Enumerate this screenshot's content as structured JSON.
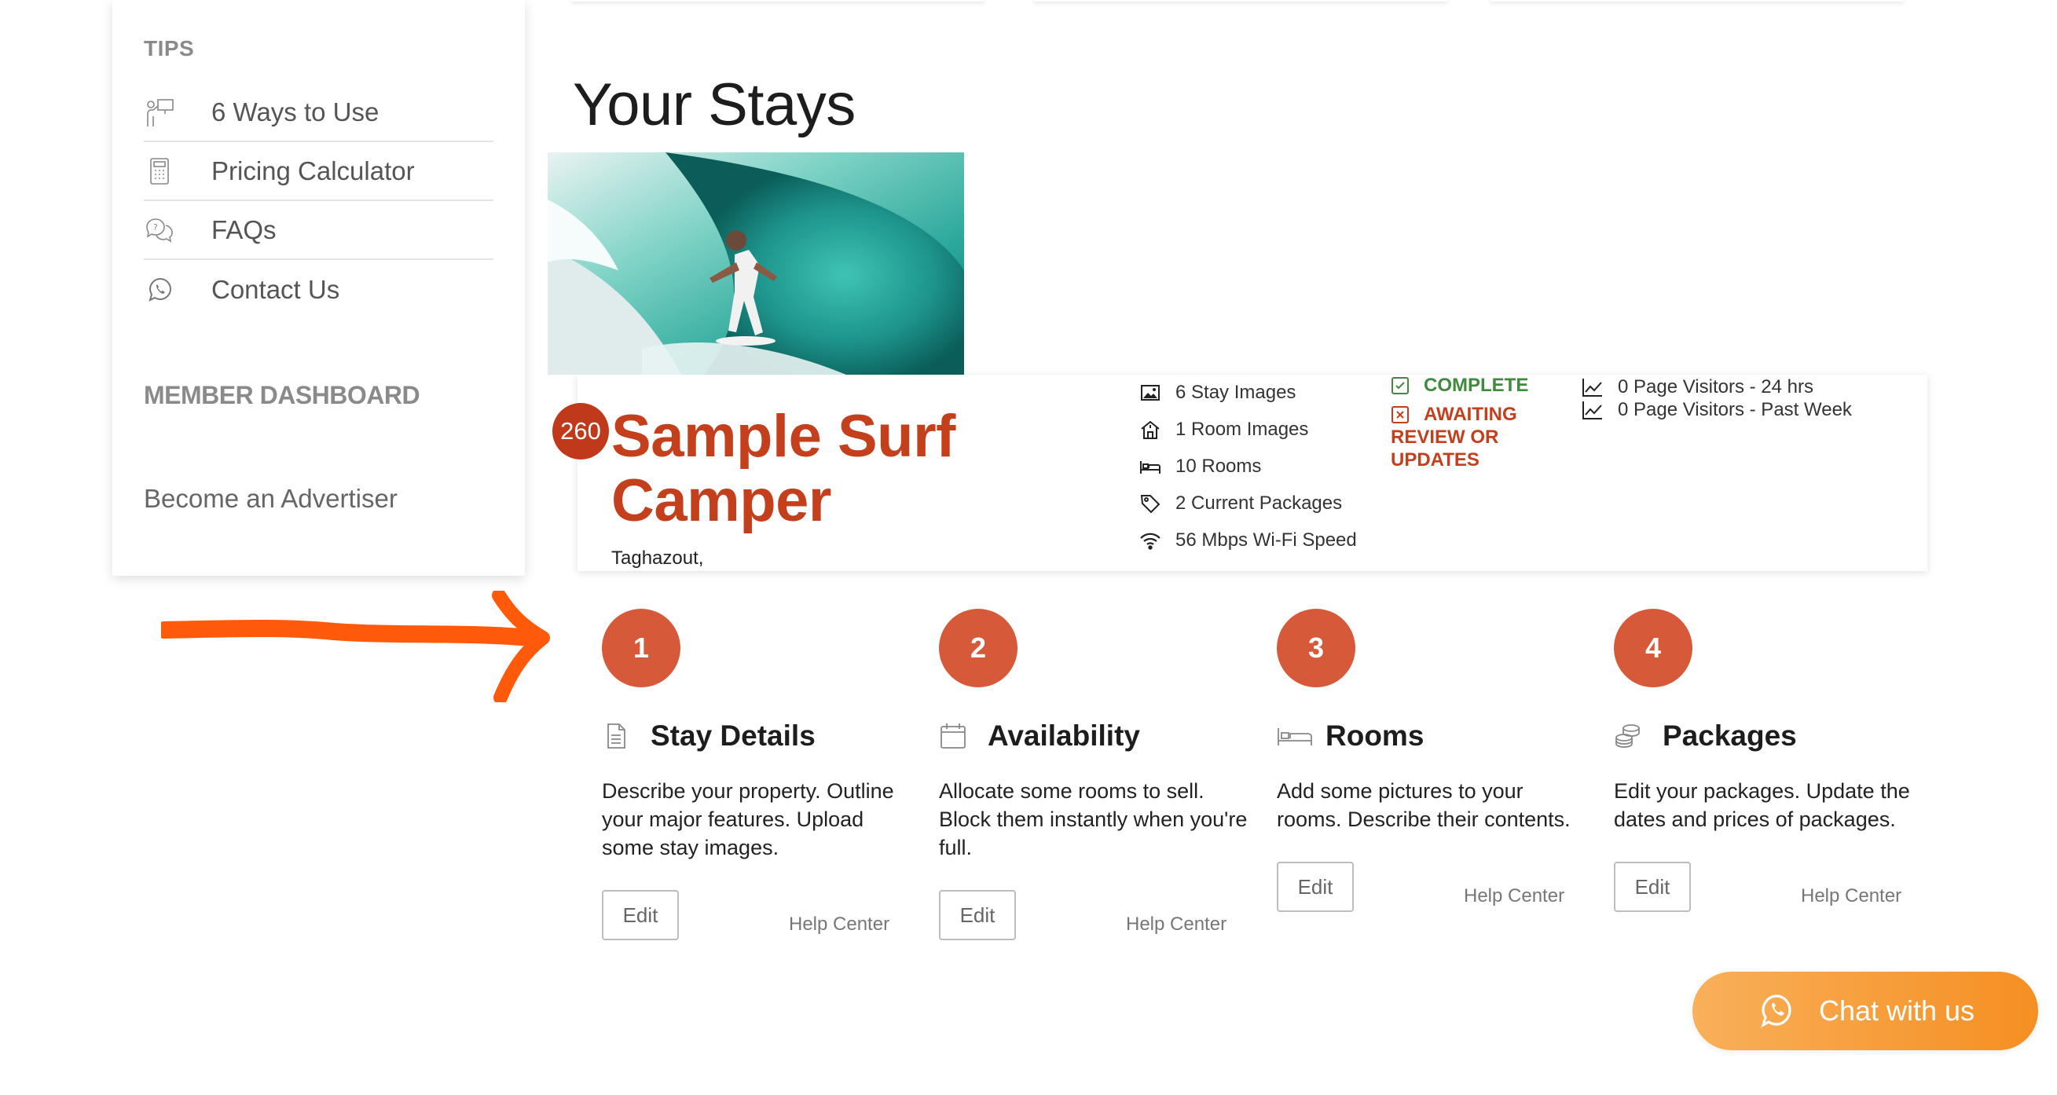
{
  "sidebar": {
    "tips_heading": "TIPS",
    "tips": [
      {
        "label": "6 Ways to Use",
        "icon": "presenter-icon"
      },
      {
        "label": "Pricing Calculator",
        "icon": "calculator-icon"
      },
      {
        "label": "FAQs",
        "icon": "chat-bubbles-icon"
      },
      {
        "label": "Contact Us",
        "icon": "whatsapp-icon"
      }
    ],
    "member_heading": "MEMBER DASHBOARD",
    "advertiser_link": "Become an Advertiser"
  },
  "page": {
    "title": "Your Stays"
  },
  "stay": {
    "badge": "260",
    "name": "Sample Surf Camper",
    "location": "Taghazout,",
    "image": "surfer-in-wave-photo",
    "stats": [
      {
        "label": "6 Stay Images",
        "icon": "image-icon"
      },
      {
        "label": "1 Room Images",
        "icon": "house-icon"
      },
      {
        "label": "10 Rooms",
        "icon": "bed-icon"
      },
      {
        "label": "2 Current Packages",
        "icon": "tag-icon"
      },
      {
        "label": "56 Mbps Wi-Fi Speed",
        "icon": "wifi-icon"
      }
    ],
    "status_complete": "COMPLETE",
    "status_awaiting": "AWAITING REVIEW OR UPDATES",
    "visitors": [
      {
        "label": "0 Page Visitors - 24 hrs",
        "icon": "chart-line-icon"
      },
      {
        "label": "0 Page Visitors - Past Week",
        "icon": "chart-line-icon"
      }
    ]
  },
  "steps": [
    {
      "number": "1",
      "title": "Stay Details",
      "icon": "document-icon",
      "description": "Describe your property. Outline your major features. Upload some stay images.",
      "edit_label": "Edit",
      "help_label": "Help Center"
    },
    {
      "number": "2",
      "title": "Availability",
      "icon": "calendar-icon",
      "description": "Allocate some rooms to sell. Block them instantly when you're full.",
      "edit_label": "Edit",
      "help_label": "Help Center"
    },
    {
      "number": "3",
      "title": "Rooms",
      "icon": "bed-icon",
      "description": "Add some pictures to your rooms. Describe their contents.",
      "edit_label": "Edit",
      "help_label": "Help Center"
    },
    {
      "number": "4",
      "title": "Packages",
      "icon": "coins-icon",
      "description": "Edit your packages. Update the dates and prices of packages.",
      "edit_label": "Edit",
      "help_label": "Help Center"
    }
  ],
  "chat": {
    "label": "Chat with us",
    "icon": "whatsapp-icon"
  },
  "colors": {
    "accent": "#c4401d",
    "step_circle": "#d65a3a",
    "complete": "#3f8a3c",
    "arrow": "#ff5a0a",
    "chat_gradient_start": "#f9b05a",
    "chat_gradient_end": "#f58f22"
  }
}
